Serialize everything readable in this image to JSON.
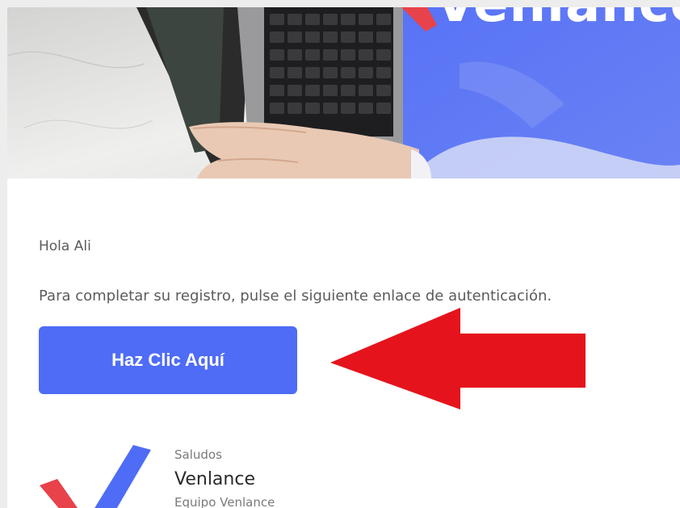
{
  "email": {
    "hero": {
      "brand_text": "Venlance"
    },
    "greeting": "Hola Ali",
    "message": "Para completar su registro, pulse el siguiente enlace de autenticación.",
    "cta_label": "Haz Clic Aquí",
    "signature": {
      "saludos": "Saludos",
      "name": "Venlance",
      "team": "Equipo Venlance"
    }
  },
  "colors": {
    "brand_blue": "#4f6cf7",
    "brand_red": "#e8424a",
    "annotation_red": "#e5141c",
    "text_gray": "#5b5b5b",
    "page_background": "#ededed"
  },
  "icons": {
    "logo": "venlance-check-logo-icon",
    "annotation": "red-arrow-left-icon"
  }
}
